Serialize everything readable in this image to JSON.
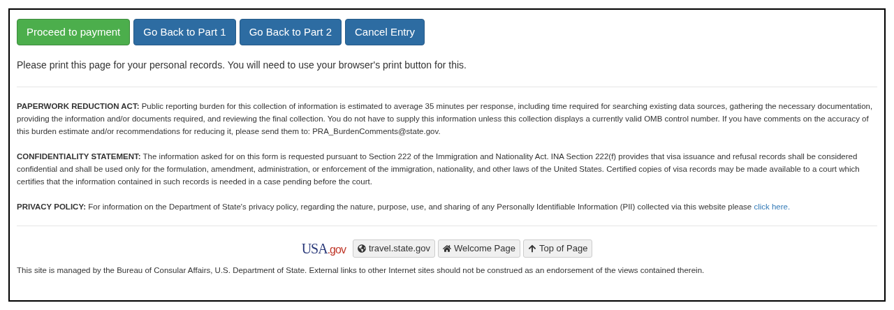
{
  "actions": [
    {
      "label": "Proceed to payment",
      "kind": "success"
    },
    {
      "label": "Go Back to Part 1",
      "kind": "primary"
    },
    {
      "label": "Go Back to Part 2",
      "kind": "primary"
    },
    {
      "label": "Cancel Entry",
      "kind": "primary"
    }
  ],
  "print_note": "Please print this page for your personal records. You will need to use your browser's print button for this.",
  "notices": [
    {
      "text": "**PAPERWORK REDUCTION ACT:** Public reporting burden for this collection of information is estimated to average 35 minutes per response, including time required for searching existing data sources, gathering the necessary documentation, providing the information and/or documents required, and reviewing the final collection. You do not have to supply this information unless this collection displays a currently valid OMB control number. If you have comments on the accuracy of this burden estimate and/or recommendations for reducing it, please send them to: PRA_BurdenComments@state.gov."
    },
    {
      "text": "**CONFIDENTIALITY STATEMENT:** The information asked for on this form is requested pursuant to Section 222 of the Immigration and Nationality Act. INA Section 222(f) provides that visa issuance and refusal records shall be considered confidential and shall be used only for the formulation, amendment, administration, or enforcement of the immigration, nationality, and other laws of the United States. Certified copies of visa records may be made available to a court which certifies that the information contained in such records is needed in a case pending before the court."
    },
    {
      "text": "**PRIVACY POLICY:** For information on the Department of State's privacy policy, regarding the nature, purpose, use, and sharing of any Personally Identifiable Information (PII) collected via this website please",
      "link": "click here."
    }
  ],
  "footer": {
    "logo": {
      "main": "USA",
      "suffix": ".gov"
    },
    "links": [
      {
        "label": "travel.state.gov",
        "kind": "external"
      },
      {
        "label": "Welcome Page",
        "kind": "home"
      },
      {
        "label": "Top of Page",
        "kind": "top"
      }
    ],
    "disclaimer": "This site is managed by the Bureau of Consular Affairs, U.S. Department of State. External links to other Internet sites should not be construed as an endorsement of the views contained therein."
  }
}
